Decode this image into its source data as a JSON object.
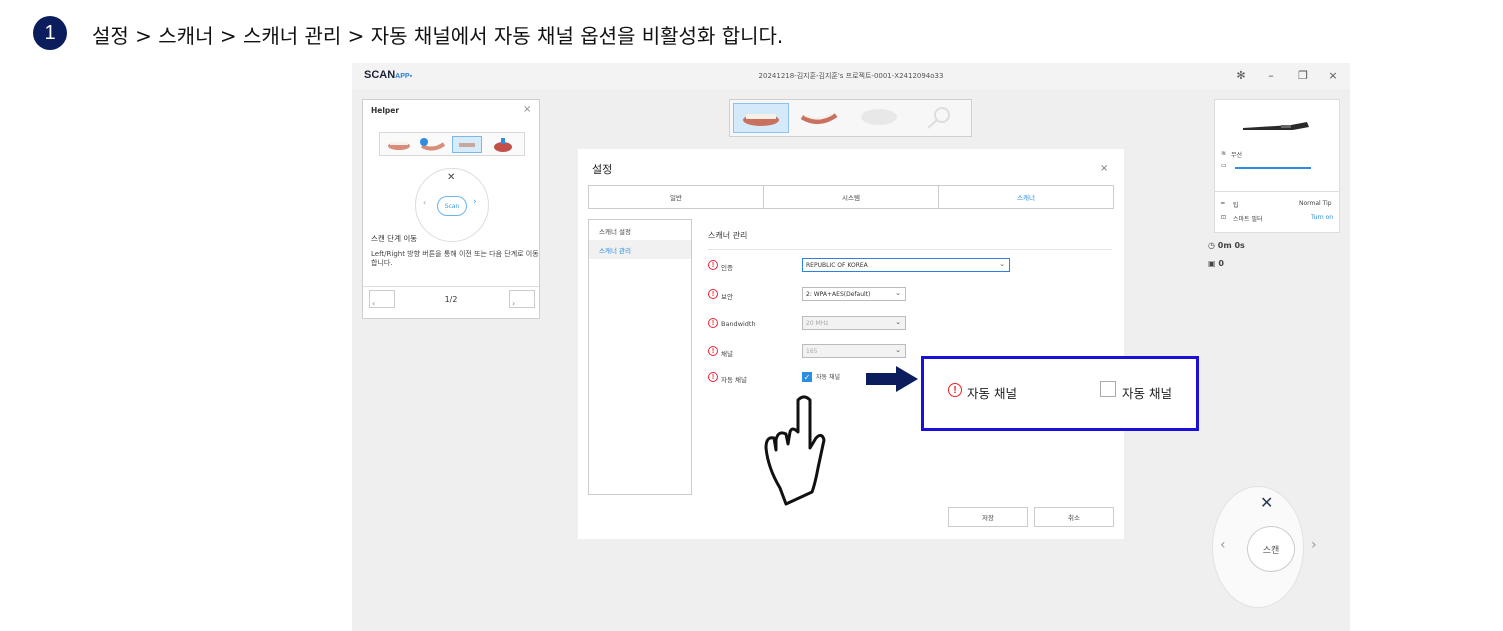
{
  "instruction": {
    "step": "1",
    "text": "설정 > 스캐너 > 스캐너 관리 > 자동 채널에서 자동 채널 옵션을 비활성화 합니다."
  },
  "app": {
    "logo": "SCAN",
    "logo_sub": "APP",
    "window_title": "20241218-김지훈-김지훈's 프로젝트-0001-X2412094o33",
    "window_controls": {
      "settings_icon": "gear-icon",
      "minimize": "–",
      "restore": "❐",
      "close": "×"
    }
  },
  "helper": {
    "title": "Helper",
    "label": "스캔 단계 이동",
    "description": "Left/Right 방향 버튼을 통해 이전 또는 다음 단계로 이동합니다.",
    "scan_label": "Scan",
    "page": "1/2"
  },
  "dialog": {
    "title": "설정",
    "tabs": [
      "일반",
      "시스템",
      "스캐너"
    ],
    "active_tab": 2,
    "nav": [
      "스캐너 설정",
      "스캐너 관리"
    ],
    "section_title": "스캐너 관리",
    "rows": [
      {
        "label": "인증",
        "value": "REPUBLIC OF KOREA"
      },
      {
        "label": "보안",
        "value": "2: WPA+AES(Default)"
      },
      {
        "label": "Bandwidth",
        "value": "20 MHz"
      },
      {
        "label": "채널",
        "value": "165"
      },
      {
        "label": "자동 채널",
        "checkbox_label": "자동 채널",
        "checked": true
      }
    ],
    "save": "저장",
    "cancel": "취소"
  },
  "right_panel": {
    "wireless": "무선",
    "tip_label": "팁",
    "tip_value": "Normal Tip",
    "filter_label": "스마트 필터",
    "filter_value": "Turn on",
    "time": "0m 0s",
    "count": "0",
    "scan_button": "스캔"
  },
  "callout": {
    "label": "자동 채널",
    "checkbox_label": "자동 채널",
    "checked": false
  },
  "colors": {
    "accent": "#2d8ee0",
    "callout_border": "#1a10d8",
    "arrow": "#0b1d5c",
    "badge": "#0b1d5c",
    "warning": "#e22222"
  }
}
